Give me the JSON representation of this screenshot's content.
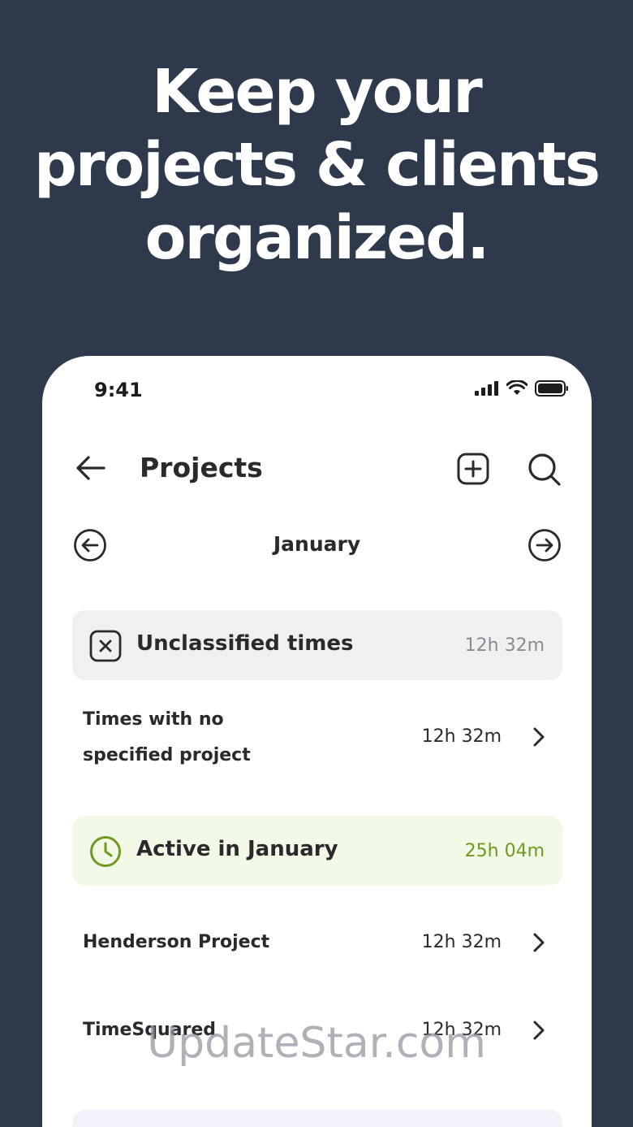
{
  "headline": {
    "line1": "Keep your",
    "line2": "projects & clients",
    "line3": "organized."
  },
  "status_bar": {
    "time": "9:41",
    "icons": [
      "signal-icon",
      "wifi-icon",
      "battery-icon"
    ]
  },
  "header": {
    "title": "Projects",
    "icons": [
      "back-arrow-icon",
      "add-square-icon",
      "search-icon"
    ]
  },
  "month_nav": {
    "label": "January",
    "icons": [
      "circle-arrow-left-icon",
      "circle-arrow-right-icon"
    ]
  },
  "sections": [
    {
      "title": "Unclassified times",
      "total": "12h 32m",
      "icon": "x-square-icon",
      "rows": [
        {
          "label": "Times with no specified project",
          "value": "12h 32m"
        }
      ]
    },
    {
      "title": "Active in January",
      "total": "25h 04m",
      "icon": "clock-icon",
      "rows": [
        {
          "label": "Henderson Project",
          "value": "12h 32m"
        },
        {
          "label": "TimeSquared",
          "value": "12h 32m"
        }
      ]
    }
  ],
  "watermark": "UpdateStar.com",
  "colors": {
    "background": "#2e394b",
    "accent_green": "#6f9a1f",
    "card_grey": "#f0f0f2",
    "card_green": "#f2f9e6"
  }
}
